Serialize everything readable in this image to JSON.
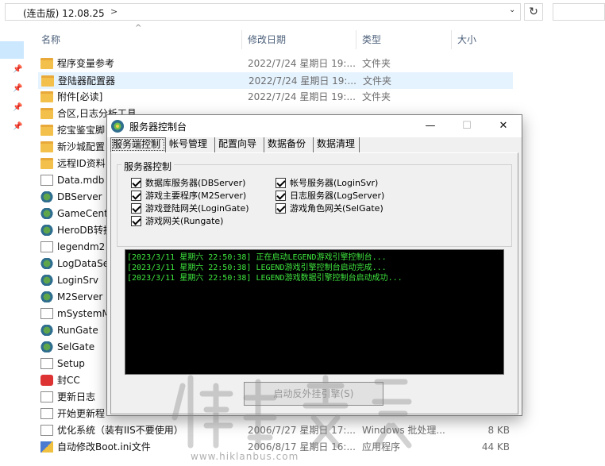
{
  "address_bar": {
    "path_text": "(连击版) 12.08.25",
    "chevron": ">"
  },
  "columns": {
    "name": "名称",
    "date": "修改日期",
    "type": "类型",
    "size": "大小"
  },
  "files": [
    {
      "name": "程序变量参考",
      "date": "2022/7/24 星期日 19:...",
      "type": "文件夹",
      "size": "",
      "icon": "folder"
    },
    {
      "name": "登陆器配置器",
      "date": "2022/7/24 星期日 19:...",
      "type": "文件夹",
      "size": "",
      "icon": "folder"
    },
    {
      "name": "附件[必读]",
      "date": "2022/7/24 星期日 19:...",
      "type": "文件夹",
      "size": "",
      "icon": "folder"
    },
    {
      "name": "合区,日志分析工具",
      "date": "",
      "type": "",
      "size": "",
      "icon": "folder"
    },
    {
      "name": "挖宝鉴宝脚",
      "date": "",
      "type": "",
      "size": "",
      "icon": "folder"
    },
    {
      "name": "新沙城配置",
      "date": "",
      "type": "",
      "size": "",
      "icon": "folder"
    },
    {
      "name": "远程ID资料",
      "date": "",
      "type": "",
      "size": "",
      "icon": "folder"
    },
    {
      "name": "Data.mdb",
      "date": "",
      "type": "",
      "size": "",
      "icon": "doc"
    },
    {
      "name": "DBServer",
      "date": "",
      "type": "",
      "size": "",
      "icon": "gear"
    },
    {
      "name": "GameCente",
      "date": "",
      "type": "",
      "size": "",
      "icon": "gear"
    },
    {
      "name": "HeroDB转换",
      "date": "",
      "type": "",
      "size": "",
      "icon": "gear"
    },
    {
      "name": "legendm2",
      "date": "",
      "type": "",
      "size": "",
      "icon": "doc"
    },
    {
      "name": "LogDataSe",
      "date": "",
      "type": "",
      "size": "",
      "icon": "gear"
    },
    {
      "name": "LoginSrv",
      "date": "",
      "type": "",
      "size": "",
      "icon": "gear"
    },
    {
      "name": "M2Server",
      "date": "",
      "type": "",
      "size": "",
      "icon": "gear"
    },
    {
      "name": "mSystemM",
      "date": "",
      "type": "",
      "size": "",
      "icon": "doc"
    },
    {
      "name": "RunGate",
      "date": "",
      "type": "",
      "size": "",
      "icon": "gear"
    },
    {
      "name": "SelGate",
      "date": "",
      "type": "",
      "size": "",
      "icon": "gear"
    },
    {
      "name": "Setup",
      "date": "",
      "type": "",
      "size": "",
      "icon": "doc"
    },
    {
      "name": "封CC",
      "date": "",
      "type": "",
      "size": "",
      "icon": "red"
    },
    {
      "name": "更新日志",
      "date": "",
      "type": "",
      "size": "",
      "icon": "doc"
    },
    {
      "name": "开始更新程",
      "date": "",
      "type": "",
      "size": "",
      "icon": "doc"
    },
    {
      "name": "优化系统（装有IIS不要使用）",
      "date": "2006/7/27 星期日 17:...",
      "type": "Windows 批处理...",
      "size": "8 KB",
      "icon": "doc"
    },
    {
      "name": "自动修改Boot.ini文件",
      "date": "2006/8/17 星期日 16:...",
      "type": "应用程序",
      "size": "44 KB",
      "icon": "pen"
    }
  ],
  "dialog": {
    "title": "服务器控制台",
    "minimize": "—",
    "maximize": "☐",
    "close": "✕",
    "tabs": [
      "服务端控制",
      "帐号管理",
      "配置向导",
      "数据备份",
      "数据清理"
    ],
    "group_title": "服务器控制",
    "checkboxes": [
      {
        "label": "数据库服务器(DBServer)",
        "checked": true
      },
      {
        "label": "帐号服务器(LoginSvr)",
        "checked": true
      },
      {
        "label": "游戏主要程序(M2Server)",
        "checked": true
      },
      {
        "label": "日志服务器(LogServer)",
        "checked": true
      },
      {
        "label": "游戏登陆网关(LoginGate)",
        "checked": true
      },
      {
        "label": "游戏角色网关(SelGate)",
        "checked": true
      },
      {
        "label": "游戏网关(Rungate)",
        "checked": true
      }
    ],
    "log_lines": [
      "[2023/3/11 星期六 22:50:38] 正在启动LEGEND游戏引擎控制台...",
      "[2023/3/11 星期六 22:50:38] LEGEND游戏引擎控制台启动完成...",
      "[2023/3/11 星期六 22:50:38] LEGEND游戏数据引擎控制台启动成功..."
    ],
    "start_button": "启动反外挂引擎(S)",
    "colors": {
      "console_bg": "#000000",
      "console_text": "#3ee63e"
    }
  },
  "watermark": {
    "text": "www.hiklanbus.com"
  }
}
